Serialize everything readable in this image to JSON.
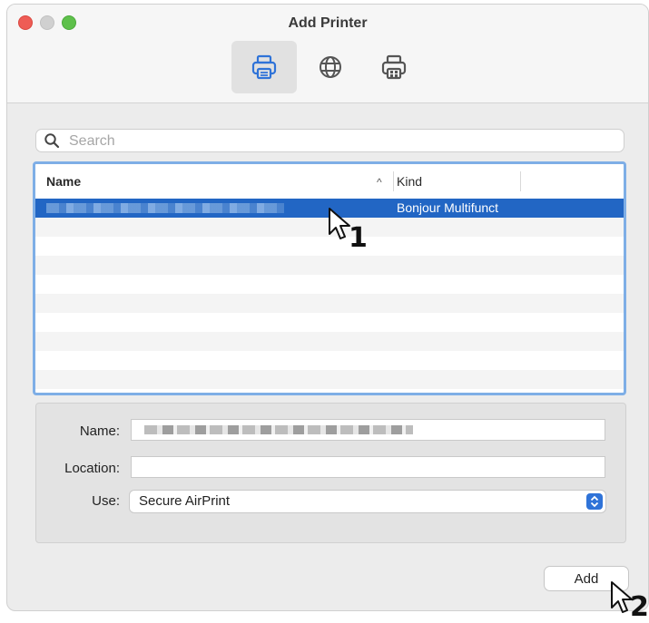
{
  "window": {
    "title": "Add Printer"
  },
  "toolbar": {
    "buttons": [
      {
        "name": "default-printer",
        "icon": "printer-icon",
        "active": true
      },
      {
        "name": "ip-printer",
        "icon": "globe-icon",
        "active": false
      },
      {
        "name": "windows-printer",
        "icon": "printer-windows-icon",
        "active": false
      }
    ]
  },
  "search": {
    "placeholder": "Search",
    "value": ""
  },
  "table": {
    "columns": [
      {
        "label": "Name",
        "sort_indicator": "^"
      },
      {
        "label": "Kind"
      }
    ],
    "rows": [
      {
        "name": "",
        "kind": "Bonjour Multifunct",
        "selected": true
      }
    ]
  },
  "form": {
    "name_label": "Name:",
    "location_label": "Location:",
    "location_value": "",
    "use_label": "Use:",
    "use_value": "Secure AirPrint"
  },
  "actions": {
    "add_label": "Add"
  },
  "callouts": {
    "first": "1",
    "second": "2"
  },
  "colors": {
    "selection": "#2266c4",
    "focus_ring": "#7eaee6",
    "accent": "#2f73d8"
  }
}
